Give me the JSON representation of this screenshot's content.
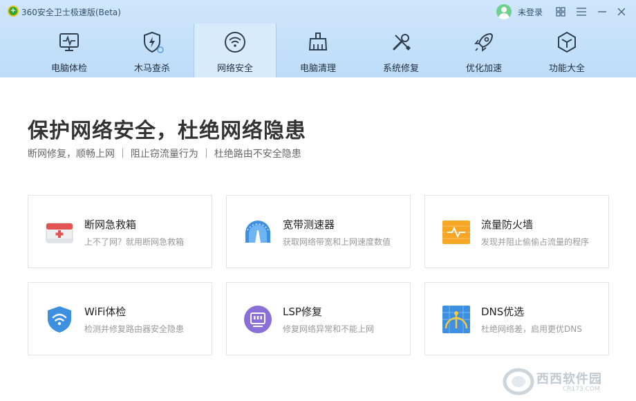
{
  "window": {
    "title": "360安全卫士极速版(Beta)",
    "login_label": "未登录"
  },
  "nav": {
    "items": [
      {
        "label": "电脑体检",
        "icon": "monitor-pulse-icon"
      },
      {
        "label": "木马查杀",
        "icon": "shield-bolt-icon"
      },
      {
        "label": "网络安全",
        "icon": "wifi-circle-icon",
        "active": true
      },
      {
        "label": "电脑清理",
        "icon": "broom-icon"
      },
      {
        "label": "系统修复",
        "icon": "wrench-screwdriver-icon"
      },
      {
        "label": "优化加速",
        "icon": "rocket-icon"
      },
      {
        "label": "功能大全",
        "icon": "cube-icon"
      }
    ]
  },
  "hero": {
    "title": "保护网络安全，杜绝网络隐患",
    "subtitle": "断网修复，顺畅上网 ｜ 阻止窃流量行为 ｜ 杜绝路由不安全隐患"
  },
  "cards": [
    {
      "title": "断网急救箱",
      "desc": "上不了网？就用断网急救箱",
      "icon": "first-aid-box-icon"
    },
    {
      "title": "宽带测速器",
      "desc": "获取网络带宽和上网速度数值",
      "icon": "speedometer-icon"
    },
    {
      "title": "流量防火墙",
      "desc": "发现并阻止偷偷占流量的程序",
      "icon": "firewall-icon"
    },
    {
      "title": "WiFi体检",
      "desc": "检测并修复路由器安全隐患",
      "icon": "wifi-shield-icon"
    },
    {
      "title": "LSP修复",
      "desc": "修复网络异常和不能上网",
      "icon": "lsp-chip-icon"
    },
    {
      "title": "DNS优选",
      "desc": "杜绝网络差，启用更优DNS",
      "icon": "dns-globe-icon"
    }
  ],
  "watermark": {
    "brand": "西西软件园",
    "url": "CR173.COM"
  },
  "colors": {
    "header_top": "#cfe6fb",
    "header_bottom": "#bddcf8",
    "nav_active": "#d8ebfc",
    "accent_blue": "#3d8fe0",
    "accent_orange": "#f6a623",
    "accent_purple": "#8b6fd8",
    "first_aid_red": "#e04848"
  }
}
